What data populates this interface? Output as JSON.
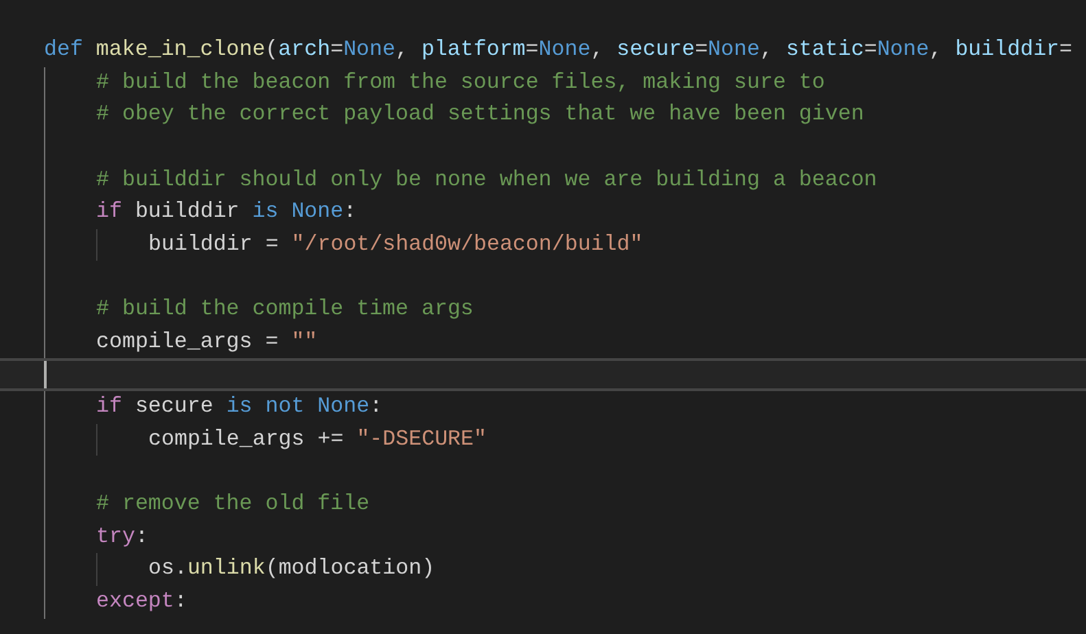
{
  "editor": {
    "lines": [
      {
        "kind": "code",
        "current": false,
        "tokens": [
          {
            "kind": "kw",
            "text": "def"
          },
          {
            "kind": "fn",
            "text": " make_in_clone"
          },
          {
            "kind": "op",
            "text": "("
          },
          {
            "kind": "param",
            "text": "arch"
          },
          {
            "kind": "op",
            "text": "="
          },
          {
            "kind": "kw",
            "text": "None"
          },
          {
            "kind": "op",
            "text": ", "
          },
          {
            "kind": "param",
            "text": "platform"
          },
          {
            "kind": "op",
            "text": "="
          },
          {
            "kind": "kw",
            "text": "None"
          },
          {
            "kind": "op",
            "text": ", "
          },
          {
            "kind": "param",
            "text": "secure"
          },
          {
            "kind": "op",
            "text": "="
          },
          {
            "kind": "kw",
            "text": "None"
          },
          {
            "kind": "op",
            "text": ", "
          },
          {
            "kind": "param",
            "text": "static"
          },
          {
            "kind": "op",
            "text": "="
          },
          {
            "kind": "kw",
            "text": "None"
          },
          {
            "kind": "op",
            "text": ", "
          },
          {
            "kind": "param",
            "text": "builddir"
          },
          {
            "kind": "op",
            "text": "="
          }
        ],
        "children": [
          {
            "kind": "code",
            "current": false,
            "tokens": [
              {
                "kind": "cm",
                "text": "# build the beacon from the source files, making sure to"
              }
            ]
          },
          {
            "kind": "code",
            "current": false,
            "tokens": [
              {
                "kind": "cm",
                "text": "# obey the correct payload settings that we have been given"
              }
            ]
          },
          {
            "kind": "blank",
            "current": false
          },
          {
            "kind": "code",
            "current": false,
            "tokens": [
              {
                "kind": "cm",
                "text": "# builddir should only be none when we are building a beacon"
              }
            ]
          },
          {
            "kind": "code",
            "current": false,
            "tokens": [
              {
                "kind": "ctrl",
                "text": "if"
              },
              {
                "kind": "op",
                "text": " builddir "
              },
              {
                "kind": "kw",
                "text": "is None"
              },
              {
                "kind": "op",
                "text": ":"
              }
            ],
            "children": [
              {
                "kind": "code",
                "current": false,
                "tokens": [
                  {
                    "kind": "op",
                    "text": "builddir = "
                  },
                  {
                    "kind": "str",
                    "text": "\"/root/shad0w/beacon/build\""
                  }
                ]
              }
            ]
          },
          {
            "kind": "blank",
            "current": false
          },
          {
            "kind": "code",
            "current": false,
            "tokens": [
              {
                "kind": "cm",
                "text": "# build the compile time args"
              }
            ]
          },
          {
            "kind": "code",
            "current": false,
            "tokens": [
              {
                "kind": "op",
                "text": "compile_args = "
              },
              {
                "kind": "str",
                "text": "\"\""
              }
            ]
          },
          {
            "kind": "blank",
            "current": true
          },
          {
            "kind": "code",
            "current": false,
            "tokens": [
              {
                "kind": "ctrl",
                "text": "if"
              },
              {
                "kind": "op",
                "text": " secure "
              },
              {
                "kind": "kw",
                "text": "is not None"
              },
              {
                "kind": "op",
                "text": ":"
              }
            ],
            "children": [
              {
                "kind": "code",
                "current": false,
                "tokens": [
                  {
                    "kind": "op",
                    "text": "compile_args += "
                  },
                  {
                    "kind": "str",
                    "text": "\"-DSECURE\""
                  }
                ]
              }
            ]
          },
          {
            "kind": "blank",
            "current": false
          },
          {
            "kind": "code",
            "current": false,
            "tokens": [
              {
                "kind": "cm",
                "text": "# remove the old file"
              }
            ]
          },
          {
            "kind": "code",
            "current": false,
            "tokens": [
              {
                "kind": "ctrl",
                "text": "try"
              },
              {
                "kind": "op",
                "text": ":"
              }
            ],
            "children": [
              {
                "kind": "code",
                "current": false,
                "tokens": [
                  {
                    "kind": "op",
                    "text": "os."
                  },
                  {
                    "kind": "fn",
                    "text": "unlink"
                  },
                  {
                    "kind": "op",
                    "text": "(modlocation)"
                  }
                ]
              }
            ]
          },
          {
            "kind": "code",
            "current": false,
            "tokens": [
              {
                "kind": "ctrl",
                "text": "except"
              },
              {
                "kind": "op",
                "text": ":"
              }
            ]
          }
        ]
      }
    ]
  }
}
